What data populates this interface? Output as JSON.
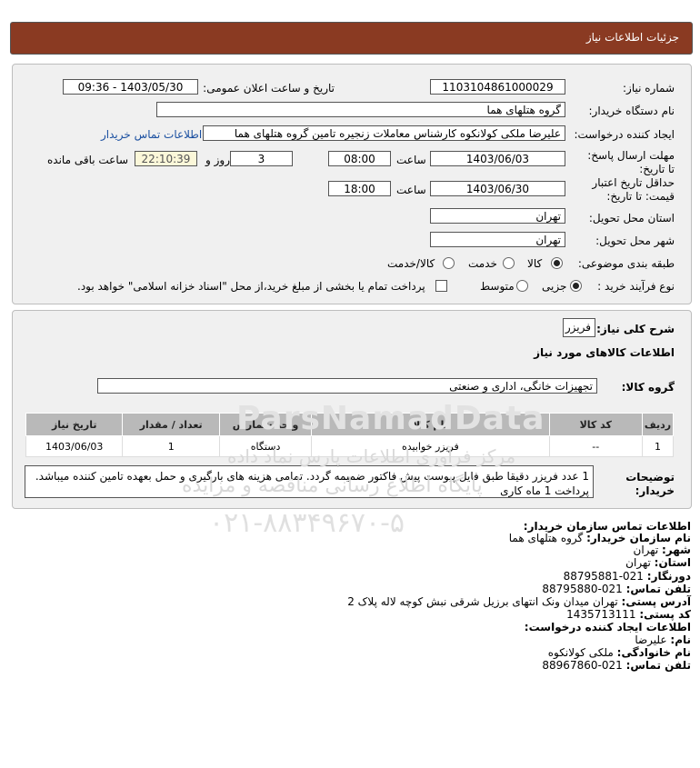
{
  "page_title": "جزئیات اطلاعات نیاز",
  "fields": {
    "need_number_label": "شماره نیاز:",
    "need_number": "1103104861000029",
    "announce_label": "تاریخ و ساعت اعلان عمومی:",
    "announce_value": "1403/05/30 - 09:36",
    "buyer_label": "نام دستگاه خریدار:",
    "buyer_value": "گروه هتلهای هما",
    "creator_label": "ایجاد کننده درخواست:",
    "creator_value": "علیرضا ملکی کولانکوه کارشناس معاملات زنجیره تامین گروه هتلهای هما",
    "buyer_contact_link": "اطلاعات تماس خریدار",
    "deadline_label": "مهلت ارسال پاسخ: تا تاریخ:",
    "deadline_date": "1403/06/03",
    "time_label": "ساعت",
    "deadline_time": "08:00",
    "days_value": "3",
    "days_label": "روز و",
    "remaining_time": "22:10:39",
    "remaining_label": "ساعت باقی مانده",
    "validity_label": "حداقل تاریخ اعتبار قیمت: تا تاریخ:",
    "validity_date": "1403/06/30",
    "validity_time": "18:00",
    "province_label": "استان محل تحویل:",
    "province_value": "تهران",
    "city_label": "شهر محل تحویل:",
    "city_value": "تهران",
    "category_label": "طبقه بندی موضوعی:",
    "category_options": [
      "کالا",
      "خدمت",
      "کالا/خدمت"
    ],
    "category_selected": "کالا",
    "process_label": "نوع فرآیند خرید :",
    "process_options": [
      "جزیی",
      "متوسط"
    ],
    "process_selected": "جزیی",
    "payment_note": "پرداخت تمام یا بخشی از مبلغ خرید،از محل \"اسناد خزانه اسلامی\" خواهد بود."
  },
  "general_desc_label": "شرح کلی نیاز:",
  "general_desc_value": "فریزر",
  "goods_info_title": "اطلاعات کالاهای مورد نیاز",
  "goods_group_label": "گروه کالا:",
  "goods_group_value": "تجهیزات خانگی، اداری و صنعتی",
  "table": {
    "headers": [
      "ردیف",
      "کد کالا",
      "نام کالا",
      "واحد شمارش",
      "تعداد / مقدار",
      "تاریخ نیاز"
    ],
    "rows": [
      [
        "1",
        "--",
        "فریزر خوابیده",
        "دستگاه",
        "1",
        "1403/06/03"
      ]
    ]
  },
  "buyer_notes_label": "توضیحات خریدار:",
  "buyer_notes_line1": "1 عدد فریزر دقیقا طبق فایل پیوست پیش فاکتور ضمیمه گردد. تمامی هزینه های بارگیری و حمل بعهده تامین کننده میباشد.",
  "buyer_notes_line2": "پرداخت 1 ماه کاری",
  "contact": {
    "title": "اطلاعات تماس سازمان خریدار:",
    "org_label": "نام سازمان خریدار:",
    "org_value": "گروه هتلهای هما",
    "city_label": "شهر:",
    "city_value": "تهران",
    "province_label": "استان:",
    "province_value": "تهران",
    "fax_label": "دورنگار:",
    "fax_value": "021-88795881",
    "phone_label": "تلفن تماس:",
    "phone_value": "021-88795880",
    "address_label": "آدرس پستی:",
    "address_value": "تهران میدان ونک انتهای برزیل شرقی نبش کوچه لاله پلاک 2",
    "postal_label": "کد پستی:",
    "postal_value": "1435713111",
    "creator_title": "اطلاعات ایجاد کننده درخواست:",
    "name_label": "نام:",
    "name_value": "علیرضا",
    "family_label": "نام خانوادگی:",
    "family_value": "ملکی کولانکوه",
    "creator_phone_label": "تلفن تماس:",
    "creator_phone_value": "021-88967860"
  },
  "watermark": {
    "brand": "ParsNamadData",
    "line1": "مرکز فرآوری اطلاعات پارس نماد داده",
    "line2": "پایگاه اطلاع رسانی مناقصه و مزایده",
    "phone": "۰۲۱-۸۸۳۴۹۶۷۰-۵"
  }
}
